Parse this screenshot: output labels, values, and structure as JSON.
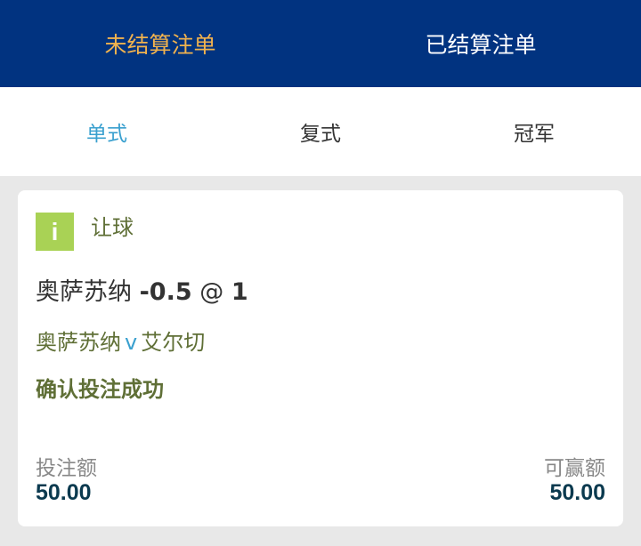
{
  "top_tabs": {
    "unsettled": "未结算注单",
    "settled": "已结算注单"
  },
  "sub_tabs": {
    "single": "单式",
    "multiple": "复式",
    "outright": "冠军"
  },
  "bet": {
    "info_icon_glyph": "i",
    "market": "让球",
    "selection_name": "奥萨苏纳",
    "handicap": "-0.5",
    "at_symbol": "@",
    "odds": "1",
    "home_team": "奥萨苏纳",
    "vs": "v",
    "away_team": "艾尔切",
    "status": "确认投注成功",
    "stake_label": "投注额",
    "stake_value": "50.00",
    "return_label": "可赢额",
    "return_value": "50.00"
  },
  "colors": {
    "header_bg": "#013380",
    "active_top_tab": "#f0b24e",
    "active_sub_tab": "#3aa0cf",
    "info_icon_bg": "#a9d255",
    "olive_text": "#5f6f36",
    "amount_text": "#0b3a4f"
  }
}
